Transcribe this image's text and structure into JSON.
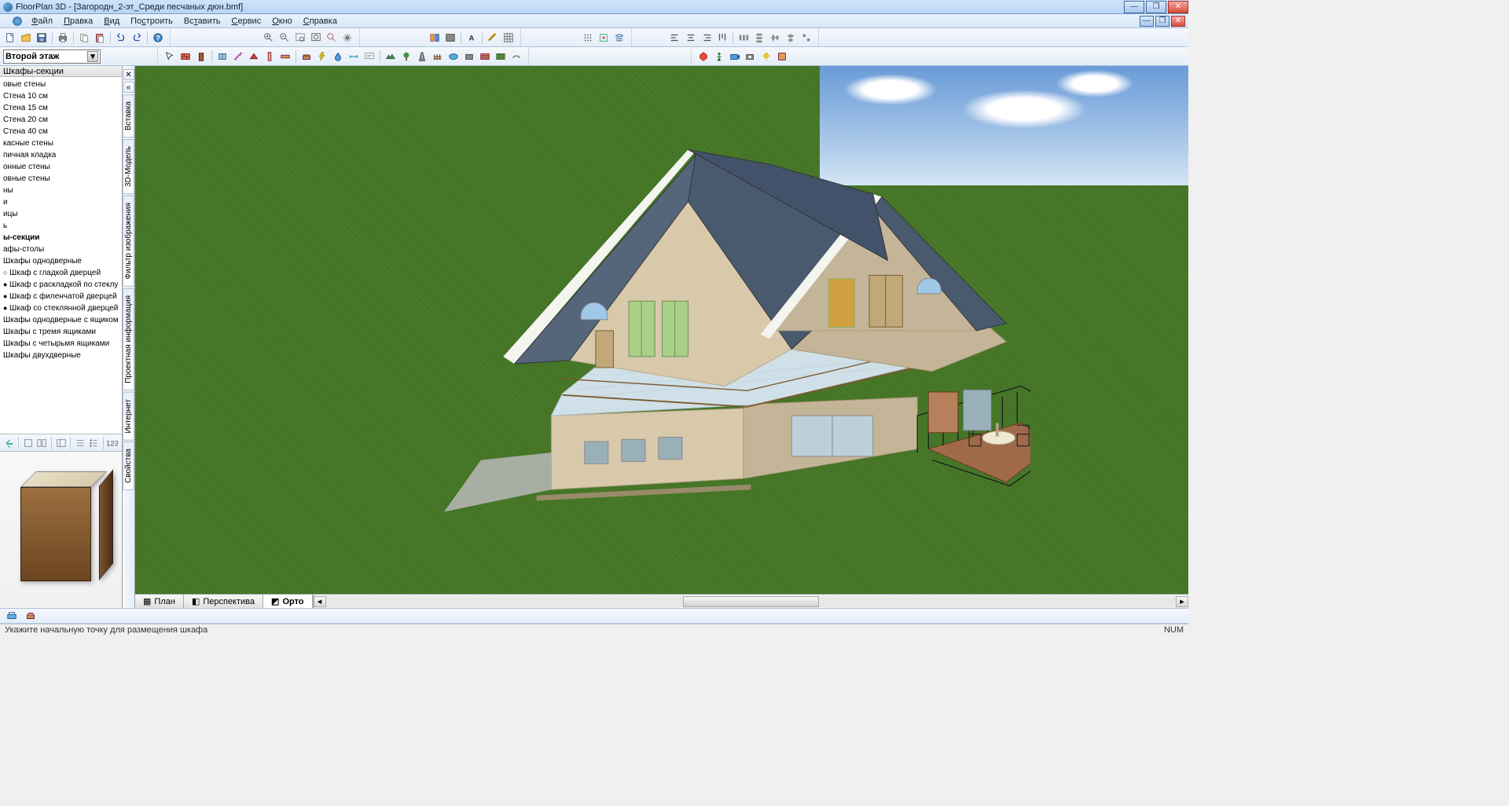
{
  "app_title": "FloorPlan 3D - [Загородн_2-эт_Среди песчаных дюн.bmf]",
  "menu": [
    "Файл",
    "Правка",
    "Вид",
    "Построить",
    "Вставить",
    "Сервис",
    "Окно",
    "Справка"
  ],
  "menu_underline_idx": [
    0,
    0,
    0,
    2,
    2,
    0,
    0,
    0
  ],
  "floor_selector": "Второй этаж",
  "left_panel_title": "Шкафы-секции",
  "items": [
    {
      "t": "овые стены"
    },
    {
      "t": "Стена 10 см"
    },
    {
      "t": "Стена 15 см"
    },
    {
      "t": "Стена 20 см"
    },
    {
      "t": "Стена 40 см"
    },
    {
      "t": "касные стены"
    },
    {
      "t": "пичная кладка"
    },
    {
      "t": "онные стены"
    },
    {
      "t": "овные стены"
    },
    {
      "t": "ны"
    },
    {
      "t": "и"
    },
    {
      "t": "ицы"
    },
    {
      "t": "ь"
    },
    {
      "t": "ы-секции",
      "bold": true
    },
    {
      "t": "афы-столы"
    },
    {
      "t": "Шкафы однодверные"
    },
    {
      "t": "Шкаф с гладкой дверцей",
      "b": "o"
    },
    {
      "t": "Шкаф с раскладкой по стеклу",
      "b": "f"
    },
    {
      "t": "Шкаф с филенчатой дверцей",
      "b": "f"
    },
    {
      "t": "Шкаф со стеклянной дверцей",
      "b": "f"
    },
    {
      "t": "Шкафы однодверные с ящиком"
    },
    {
      "t": "Шкафы с тремя ящиками"
    },
    {
      "t": "Шкафы с четырьмя ящиками"
    },
    {
      "t": "Шкафы двухдверные"
    }
  ],
  "vtabs": [
    "Вставка",
    "3D-Модель",
    "Фильтр изображения",
    "Проектная информация",
    "Интернет",
    "Свойства"
  ],
  "view_tabs": [
    {
      "label": "План",
      "icon": "grid"
    },
    {
      "label": "Перспектива",
      "icon": "cube"
    },
    {
      "label": "Орто",
      "icon": "ortho",
      "active": true
    }
  ],
  "status_hint": "Укажите начальную точку для размещения шкафа",
  "status_right": "NUM",
  "colors": {
    "roof": "#4a5a6e",
    "wall": "#d8c9ab",
    "wall_dark": "#c4b598",
    "trim": "#f5f5f0",
    "grass": "#4a7c2a",
    "sky": "#7aa8d8",
    "deck": "#a06a4a",
    "terrace": "#c8d8e0"
  }
}
